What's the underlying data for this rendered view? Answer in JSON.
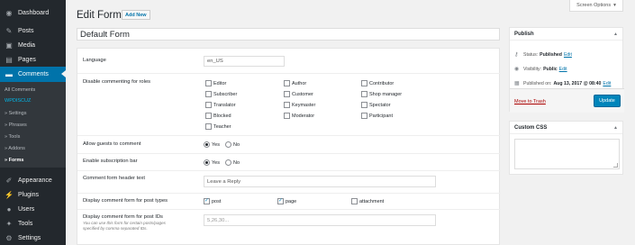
{
  "sidebar": {
    "dashboard": "Dashboard",
    "posts": "Posts",
    "media": "Media",
    "pages": "Pages",
    "comments": "Comments",
    "appearance": "Appearance",
    "plugins": "Plugins",
    "users": "Users",
    "tools": "Tools",
    "settings": "Settings",
    "submenu": {
      "all_comments": "All Comments",
      "brand": "WPDISCUZ",
      "settings": "» Settings",
      "phrases": "» Phrases",
      "tools": "» Tools",
      "addons": "» Addons",
      "forms": "» Forms"
    }
  },
  "header": {
    "title": "Edit Form",
    "add_new": "Add New",
    "screen_options": "Screen Options"
  },
  "form": {
    "title_value": "Default Form",
    "language": {
      "label": "Language",
      "value": "en_US"
    },
    "disable_roles": {
      "label": "Disable commenting for roles",
      "roles": [
        [
          "Editor",
          "Author",
          "Contributor"
        ],
        [
          "Subscriber",
          "Customer",
          "Shop manager"
        ],
        [
          "Translator",
          "Keymaster",
          "Spectator"
        ],
        [
          "Blocked",
          "Moderator",
          "Participant"
        ],
        [
          "Teacher"
        ]
      ]
    },
    "allow_guests": {
      "label": "Allow guests to comment",
      "yes": "Yes",
      "no": "No"
    },
    "subscription_bar": {
      "label": "Enable subscription bar",
      "yes": "Yes",
      "no": "No"
    },
    "header_text": {
      "label": "Comment form header text",
      "value": "Leave a Reply"
    },
    "post_types": {
      "label": "Display comment form for post types",
      "post": "post",
      "page": "page",
      "attachment": "attachment"
    },
    "post_ids": {
      "label": "Display comment form for post IDs",
      "placeholder": "5,26,30...",
      "hint": "You can use this form for certain posts/pages specified by comma separated IDs."
    }
  },
  "publish": {
    "title": "Publish",
    "status_label": "Status:",
    "status_value": "Published",
    "visibility_label": "Visibility:",
    "visibility_value": "Public",
    "published_label": "Published on:",
    "published_value": "Aug 13, 2017 @ 08:40",
    "edit": "Edit",
    "trash": "Move to Trash",
    "update": "Update"
  },
  "custom_css": {
    "title": "Custom CSS"
  }
}
